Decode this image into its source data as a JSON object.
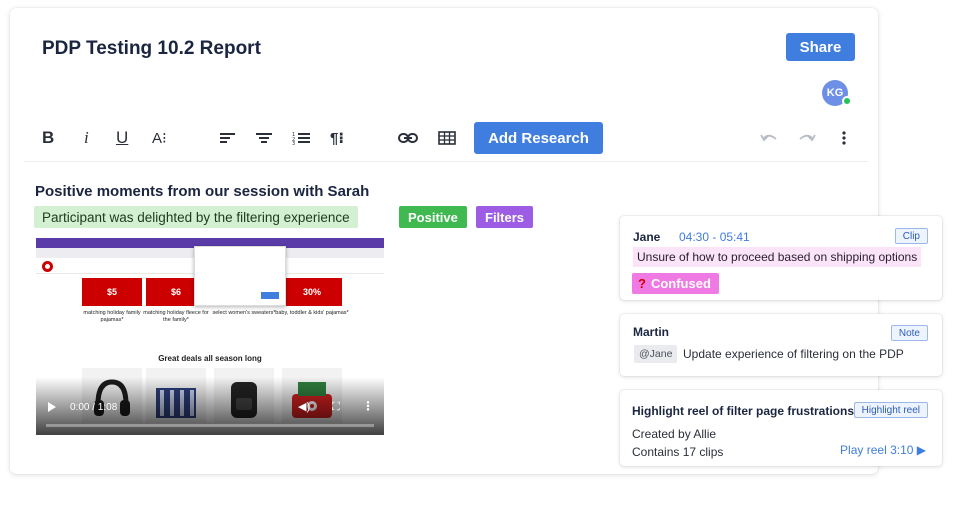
{
  "document": {
    "title": "PDP Testing 10.2 Report",
    "share_label": "Share",
    "collaborator_initials": "KG"
  },
  "toolbar": {
    "bold": "B",
    "italic": "i",
    "underline": "U",
    "text_size": "A⁝",
    "paragraph": "¶⁝",
    "add_research_label": "Add Research"
  },
  "content": {
    "section_heading": "Positive moments from our session with Sarah",
    "highlight_text": "Participant was delighted by the filtering experience",
    "tags": [
      {
        "label": "Positive",
        "color": "#3fb950"
      },
      {
        "label": "Filters",
        "color": "#9c5ce4"
      }
    ]
  },
  "video": {
    "time": "0:00 / 1:08",
    "progress": 0,
    "page": {
      "promos": [
        {
          "price": "$5",
          "caption": "matching holiday family pajamas*"
        },
        {
          "price": "$6",
          "caption": "matching holiday fleece for the family*"
        },
        {
          "price": "",
          "caption": "select women's sweaters*"
        },
        {
          "price": "30%",
          "caption": "baby, toddler & kids' pajamas*"
        }
      ],
      "deals_heading": "Great deals all season long"
    }
  },
  "panel": {
    "clip": {
      "author": "Jane",
      "timestamp": "04:30 - 05:41",
      "badge": "Clip",
      "quote": "Unsure of how to proceed based on shipping options",
      "tag_icon": "?",
      "tag": "Confused",
      "tag_color": "#f07ae3"
    },
    "note": {
      "author": "Martin",
      "badge": "Note",
      "mention": "@Jane",
      "text": "Update experience of filtering on the PDP"
    },
    "reel": {
      "title": "Highlight reel of filter page frustrations",
      "badge": "Highlight reel",
      "created_by": "Created by Allie",
      "clips": "Contains 17 clips",
      "play_label": "Play reel 3:10 ▶"
    }
  },
  "colors": {
    "accent": "#3f7ddf",
    "highlight_bg": "#d4f0d3",
    "quote_bg": "#fbe3f8",
    "presence": "#22c35b"
  }
}
